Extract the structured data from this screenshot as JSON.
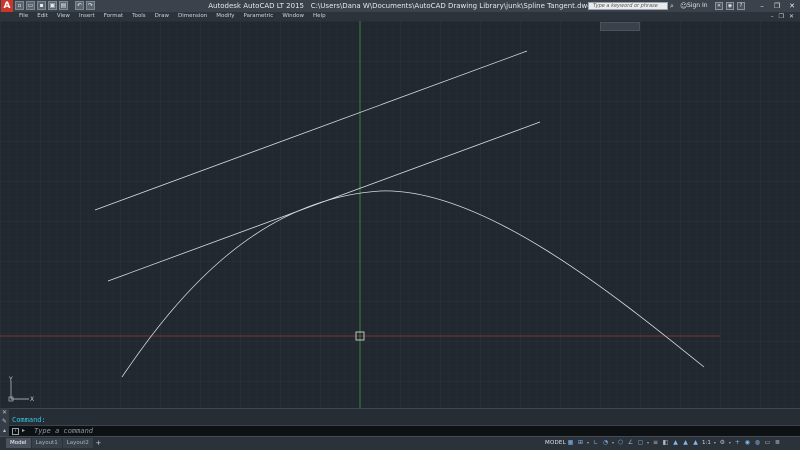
{
  "app": {
    "logo_letter": "A",
    "title": "Autodesk AutoCAD LT 2015",
    "file_path": "C:\\Users\\Dana W\\Documents\\AutoCAD Drawing Library\\junk\\Spline Tangent.dwg"
  },
  "quick_access": [
    "new-icon",
    "open-icon",
    "save-icon",
    "saveas-icon",
    "print-icon",
    "undo-icon",
    "redo-icon"
  ],
  "search": {
    "placeholder": "Type a keyword or phrase"
  },
  "signin": {
    "label": "Sign In"
  },
  "menu": {
    "items": [
      "File",
      "Edit",
      "View",
      "Insert",
      "Format",
      "Tools",
      "Draw",
      "Dimension",
      "Modify",
      "Parametric",
      "Window",
      "Help"
    ]
  },
  "canvas": {
    "background": "#212830",
    "grid_color": "#2c343d",
    "crosshair_vertical_color": "#3c9a3c",
    "crosshair_horizontal_color": "#9a3a30",
    "geometry_color": "#d8dde2"
  },
  "command": {
    "history_line": "Command:",
    "placeholder": "Type a command"
  },
  "layout_tabs": [
    "Model",
    "Layout1",
    "Layout2"
  ],
  "status": {
    "model_label": "MODEL",
    "scale": "1:1"
  }
}
